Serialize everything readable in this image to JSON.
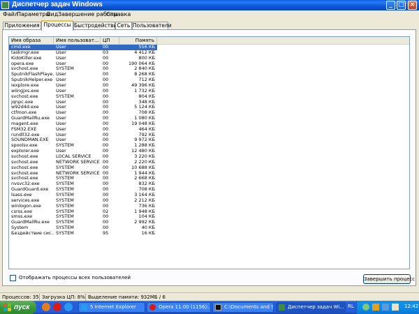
{
  "window": {
    "title": "Диспетчер задач Windows",
    "controls": {
      "minimize": "_",
      "maximize": "□",
      "close": "×"
    }
  },
  "menu": [
    "Файл",
    "Параметры",
    "Вид",
    "Завершение работы",
    "Справка"
  ],
  "tabs": [
    "Приложения",
    "Процессы",
    "Быстродействие",
    "Сеть",
    "Пользователи"
  ],
  "active_tab": "Процессы",
  "table": {
    "columns": [
      "Имя образа",
      "Имя пользоват...",
      "ЦП",
      "Память"
    ],
    "rows": [
      [
        "cmd.exe",
        "User",
        "00",
        "556 КБ"
      ],
      [
        "taskmgr.exe",
        "User",
        "03",
        "4 412 КБ"
      ],
      [
        "KidoKiller.exe",
        "User",
        "00",
        "800 КБ"
      ],
      [
        "opera.exe",
        "User",
        "00",
        "190 064 КБ"
      ],
      [
        "svchost.exe",
        "SYSTEM",
        "00",
        "2 840 КБ"
      ],
      [
        "SputnikFlashPlaye...",
        "User",
        "00",
        "8 268 КБ"
      ],
      [
        "SputnikHelper.exe",
        "User",
        "00",
        "712 КБ"
      ],
      [
        "iexplore.exe",
        "User",
        "00",
        "49 396 КБ"
      ],
      [
        "wiingjxs.exe",
        "User",
        "00",
        "1 732 КБ"
      ],
      [
        "svchost.exe",
        "SYSTEM",
        "00",
        "804 КБ"
      ],
      [
        "jqnpc.exe",
        "User",
        "00",
        "348 КБ"
      ],
      [
        "w92d4d.exe",
        "User",
        "00",
        "5 124 КБ"
      ],
      [
        "ctfmon.exe",
        "User",
        "00",
        "708 КБ"
      ],
      [
        "GuardMailRu.exe",
        "User",
        "00",
        "1 080 КБ"
      ],
      [
        "magent.exe",
        "User",
        "00",
        "19 048 КБ"
      ],
      [
        "FSM32.EXE",
        "User",
        "00",
        "464 КБ"
      ],
      [
        "rundll32.exe",
        "User",
        "00",
        "792 КБ"
      ],
      [
        "SOUNDMAN.EXE",
        "User",
        "00",
        "9 972 КБ"
      ],
      [
        "spoolsv.exe",
        "SYSTEM",
        "00",
        "1 288 КБ"
      ],
      [
        "explorer.exe",
        "User",
        "00",
        "12 480 КБ"
      ],
      [
        "svchost.exe",
        "LOCAL SERVICE",
        "00",
        "3 220 КБ"
      ],
      [
        "svchost.exe",
        "NETWORK SERVICE",
        "00",
        "2 220 КБ"
      ],
      [
        "svchost.exe",
        "SYSTEM",
        "00",
        "10 688 КБ"
      ],
      [
        "svchost.exe",
        "NETWORK SERVICE",
        "00",
        "1 944 КБ"
      ],
      [
        "svchost.exe",
        "SYSTEM",
        "00",
        "2 668 КБ"
      ],
      [
        "nvsvc32.exe",
        "SYSTEM",
        "00",
        "832 КБ"
      ],
      [
        "GuardGuard.exe",
        "SYSTEM",
        "00",
        "708 КБ"
      ],
      [
        "lsass.exe",
        "SYSTEM",
        "00",
        "3 164 КБ"
      ],
      [
        "services.exe",
        "SYSTEM",
        "00",
        "2 212 КБ"
      ],
      [
        "winlogon.exe",
        "SYSTEM",
        "00",
        "736 КБ"
      ],
      [
        "csrss.exe",
        "SYSTEM",
        "02",
        "1 948 КБ"
      ],
      [
        "smss.exe",
        "SYSTEM",
        "00",
        "104 КБ"
      ],
      [
        "GuardMailRu.exe",
        "SYSTEM",
        "00",
        "2 992 КБ"
      ],
      [
        "System",
        "SYSTEM",
        "00",
        "40 КБ"
      ],
      [
        "Бездействие сис...",
        "SYSTEM",
        "95",
        "16 КБ"
      ]
    ],
    "selected_row": "cmd.exe"
  },
  "show_all_users": {
    "label": "Отображать процессы всех пользователей",
    "checked": false
  },
  "end_process_label": "Завершить процесс",
  "status": {
    "processes": "Процессов: 35",
    "cpu": "Загрузка ЦП: 8%",
    "memory": "Выделение памяти: 932МБ / 6"
  },
  "taskbar": {
    "start_label": "пуск",
    "tasks": [
      {
        "label": "5 Internet Explorer",
        "icon": "ie-icon",
        "color": "#2A9AF0"
      },
      {
        "label": "Opera 11.00 (1156):...",
        "icon": "opera-icon",
        "color": "#D91A1A"
      },
      {
        "label": "C:\\Documents and Se...",
        "icon": "cmd-icon",
        "color": "#111111"
      },
      {
        "label": "Диспетчер задач Wi...",
        "icon": "taskmgr-icon",
        "color": "#3F8E3F"
      }
    ],
    "active_task": "Диспетчер задач Wi...",
    "lang": "RL",
    "clock": "12:42"
  },
  "colors": {
    "title": "#0A5FE8",
    "selection": "#316AC5",
    "taskbar": "#245EDB",
    "tray": "#0D8DEA",
    "start": "#3A973A"
  }
}
